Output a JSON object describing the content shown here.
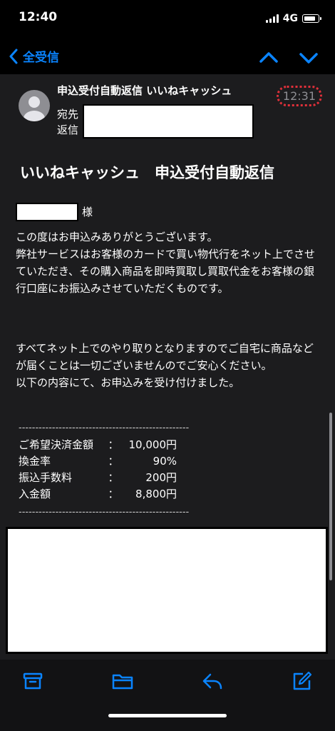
{
  "status": {
    "time": "12:40",
    "network": "4G"
  },
  "nav": {
    "back_label": "全受信"
  },
  "header": {
    "subject": "申込受付自動返信 いいねキャッシュ",
    "time": "12:31",
    "to_label": "宛先",
    "reply_label": "返信"
  },
  "mail": {
    "title": "いいねキャッシュ　申込受付自動返信",
    "honorific": "様",
    "paragraph1": "この度はお申込みありがとうございます。\n弊社サービスはお客様のカードで買い物代行をネット上でさせていただき、その購入商品を即時買取し買取代金をお客様の銀行口座にお振込みさせていただくものです。",
    "paragraph2": "すべてネット上でのやり取りとなりますのでご自宅に商品などが届くことは一切ございませんのでご安心ください。\n以下の内容にて、お申込みを受け付けました。",
    "divider": "---------------------------------------------------",
    "rows": [
      {
        "label": "ご希望決済金額",
        "colon": "：",
        "value": "10,000円"
      },
      {
        "label": "換金率",
        "colon": "：",
        "value": "90%"
      },
      {
        "label": "振込手数料",
        "colon": "：",
        "value": "200円"
      },
      {
        "label": "入金額",
        "colon": "：",
        "value": "8,800円"
      }
    ]
  },
  "colors": {
    "accent": "#0a84ff",
    "highlight": "#e0303a"
  },
  "toolbar": {
    "icons": [
      "archive-icon",
      "folder-icon",
      "reply-icon",
      "compose-icon"
    ]
  }
}
